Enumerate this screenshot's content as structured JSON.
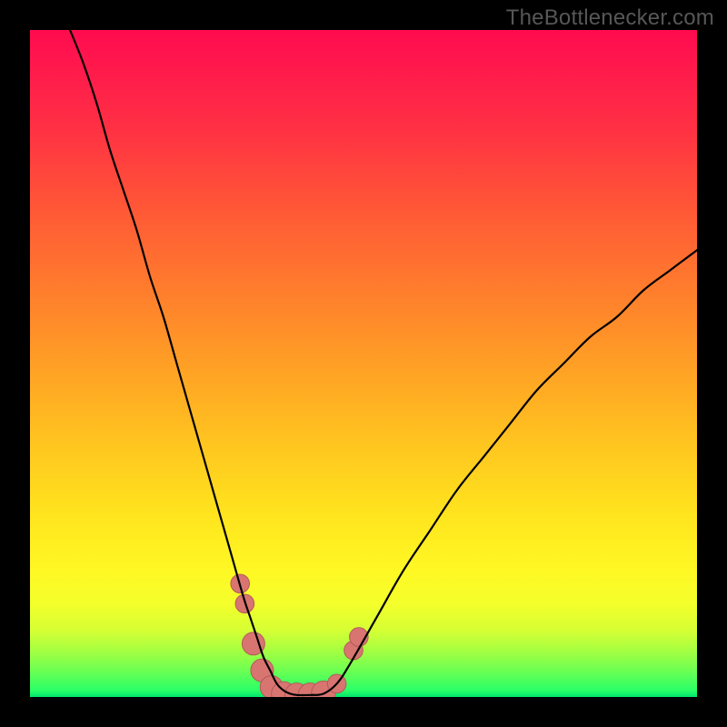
{
  "watermark": "TheBottlenecker.com",
  "colors": {
    "frame_bg": "#000000",
    "curve_stroke": "#000000",
    "marker_fill": "#d87571",
    "marker_stroke": "#b15b59",
    "gradient_stops": [
      {
        "pct": 0,
        "hex": "#ff0b4f"
      },
      {
        "pct": 6,
        "hex": "#ff1a4c"
      },
      {
        "pct": 15,
        "hex": "#ff3143"
      },
      {
        "pct": 27,
        "hex": "#ff5836"
      },
      {
        "pct": 40,
        "hex": "#ff802c"
      },
      {
        "pct": 52,
        "hex": "#ffa524"
      },
      {
        "pct": 63,
        "hex": "#ffc81f"
      },
      {
        "pct": 73,
        "hex": "#ffe51e"
      },
      {
        "pct": 81,
        "hex": "#fff824"
      },
      {
        "pct": 86,
        "hex": "#f4ff2b"
      },
      {
        "pct": 90,
        "hex": "#d6ff34"
      },
      {
        "pct": 93,
        "hex": "#a6ff41"
      },
      {
        "pct": 96,
        "hex": "#6dff52"
      },
      {
        "pct": 99,
        "hex": "#2aff67"
      },
      {
        "pct": 100,
        "hex": "#00e46d"
      }
    ]
  },
  "chart_data": {
    "type": "line",
    "title": "",
    "xlabel": "",
    "ylabel": "",
    "xlim": [
      0,
      100
    ],
    "ylim": [
      0,
      100
    ],
    "series": [
      {
        "name": "bottleneck-curve",
        "x": [
          6,
          8,
          10,
          12,
          14,
          16,
          18,
          20,
          22,
          24,
          26,
          28,
          30,
          32,
          33,
          34,
          35,
          36,
          37,
          38,
          39,
          40,
          42,
          44,
          46,
          48,
          52,
          56,
          60,
          64,
          68,
          72,
          76,
          80,
          84,
          88,
          92,
          96,
          100
        ],
        "y": [
          100,
          95,
          89,
          82,
          76,
          70,
          63,
          57,
          50,
          43,
          36,
          29,
          22,
          15,
          12,
          9,
          6,
          4,
          2,
          1,
          0.5,
          0.3,
          0.3,
          0.5,
          2,
          5,
          12,
          19,
          25,
          31,
          36,
          41,
          46,
          50,
          54,
          57,
          61,
          64,
          67
        ]
      }
    ],
    "markers": [
      {
        "x": 31.5,
        "y": 17,
        "r": 1.4
      },
      {
        "x": 32.2,
        "y": 14,
        "r": 1.4
      },
      {
        "x": 33.5,
        "y": 8,
        "r": 1.7
      },
      {
        "x": 34.8,
        "y": 4,
        "r": 1.7
      },
      {
        "x": 36.2,
        "y": 1.5,
        "r": 1.7
      },
      {
        "x": 38.0,
        "y": 0.5,
        "r": 1.8
      },
      {
        "x": 40.0,
        "y": 0.3,
        "r": 1.8
      },
      {
        "x": 42.0,
        "y": 0.3,
        "r": 1.8
      },
      {
        "x": 44.0,
        "y": 0.6,
        "r": 1.8
      },
      {
        "x": 46.0,
        "y": 2.0,
        "r": 1.4
      },
      {
        "x": 48.5,
        "y": 7.0,
        "r": 1.4
      },
      {
        "x": 49.3,
        "y": 9.0,
        "r": 1.4
      }
    ],
    "annotations": []
  }
}
